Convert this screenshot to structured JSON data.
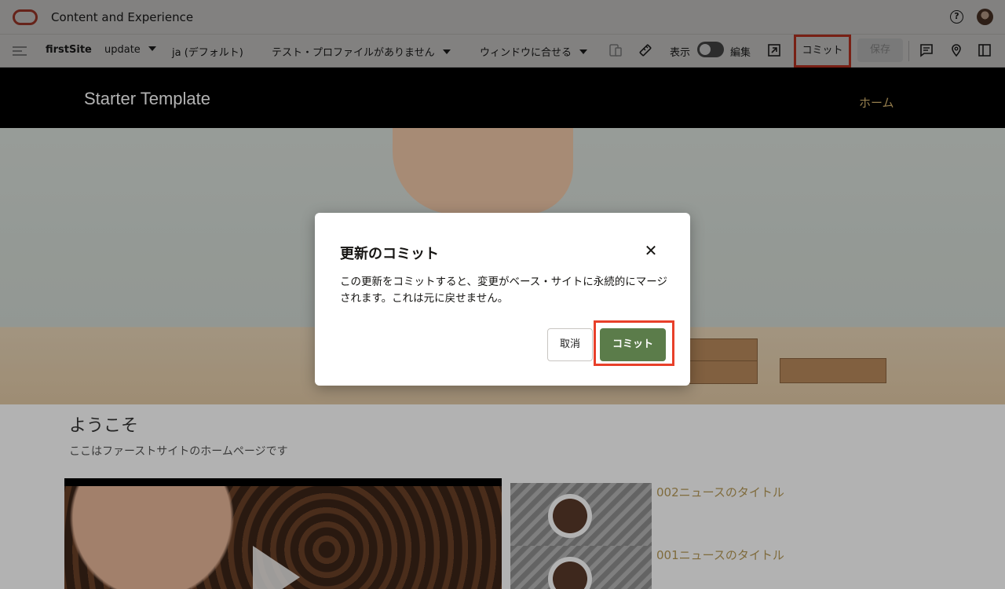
{
  "app": {
    "title": "Content and Experience"
  },
  "toolbar": {
    "site_name": "firstSite",
    "update": "update",
    "language": "ja (デフォルト)",
    "profile": "テスト・プロファイルがありません",
    "fit": "ウィンドウに合せる",
    "view_label": "表示",
    "edit_label": "編集",
    "commit_label": "コミット",
    "save_label": "保存"
  },
  "site": {
    "title": "Starter Template",
    "nav_home": "ホーム",
    "welcome": "ようこそ",
    "subtext": "ここはファーストサイトのホームページです",
    "news": [
      {
        "title": "002ニュースのタイトル"
      },
      {
        "title": "001ニュースのタイトル"
      }
    ]
  },
  "dialog": {
    "title": "更新のコミット",
    "body": "この更新をコミットすると、変更がベース・サイトに永続的にマージされます。これは元に戻せません。",
    "cancel_label": "取消",
    "commit_label": "コミット"
  },
  "colors": {
    "highlight": "#e8402a",
    "commit_button": "#5b7c4a",
    "brand": "#c74634",
    "nav_gold": "#d6b56f"
  }
}
